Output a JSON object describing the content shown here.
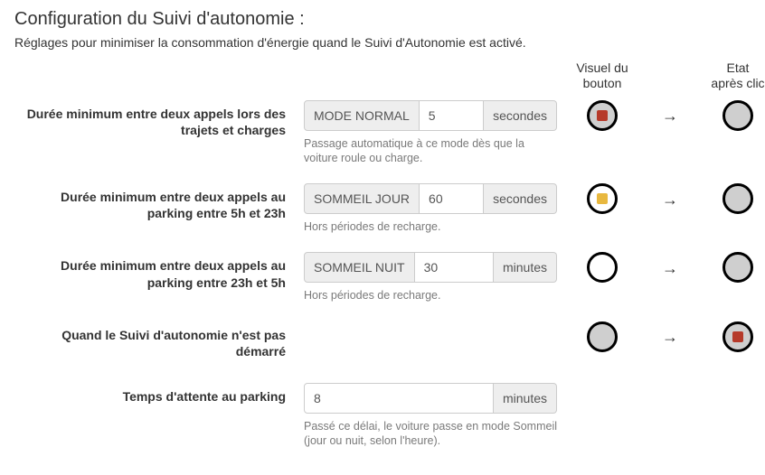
{
  "page": {
    "title": "Configuration du Suivi d'autonomie :",
    "subtitle": "Réglages pour minimiser la consommation d'énergie quand le Suivi d'Autonomie est activé."
  },
  "headers": {
    "visual": "Visuel du bouton",
    "after": "Etat après clic"
  },
  "arrow": "→",
  "rows": {
    "normal": {
      "label": "Durée minimum entre deux appels lors des trajets et charges",
      "mode": "MODE NORMAL",
      "value": "5",
      "unit": "secondes",
      "help": "Passage automatique à ce mode dès que la voiture roule ou charge."
    },
    "day": {
      "label": "Durée minimum entre deux appels au parking entre 5h et 23h",
      "mode": "SOMMEIL JOUR",
      "value": "60",
      "unit": "secondes",
      "help": "Hors périodes de recharge."
    },
    "night": {
      "label": "Durée minimum entre deux appels au parking entre 23h et 5h",
      "mode": "SOMMEIL NUIT",
      "value": "30",
      "unit": "minutes",
      "help": "Hors périodes de recharge."
    },
    "stopped": {
      "label": "Quand le Suivi d'autonomie n'est pas démarré"
    },
    "wait": {
      "label": "Temps d'attente au parking",
      "value": "8",
      "unit": "minutes",
      "help": "Passé ce délai, le voiture passe en mode Sommeil (jour ou nuit, selon l'heure)."
    }
  }
}
